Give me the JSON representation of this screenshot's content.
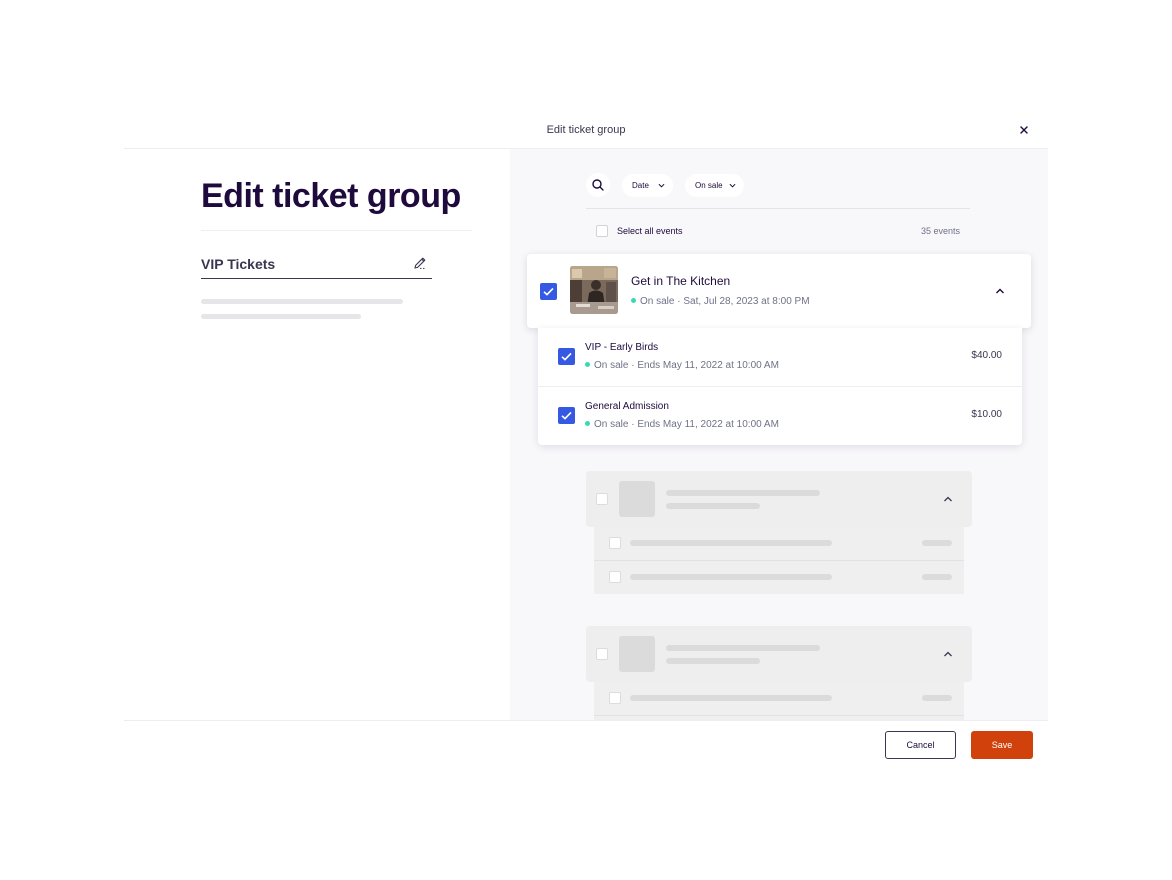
{
  "header": {
    "title": "Edit ticket group",
    "close_icon": "close-icon"
  },
  "left": {
    "title": "Edit ticket group",
    "group_name": "VIP Tickets",
    "edit_icon": "pencil-icon"
  },
  "toolbar": {
    "search_icon": "search-icon",
    "filters": [
      {
        "label": "Date"
      },
      {
        "label": "On sale"
      }
    ],
    "select_all_label": "Select all events",
    "event_count": "35 events"
  },
  "event": {
    "name": "Get in The Kitchen",
    "meta": "On sale · Sat, Jul 28, 2023 at 8:00 PM",
    "checked": true,
    "tickets": [
      {
        "name": "VIP - Early Birds",
        "meta": "On sale · Ends May 11, 2022 at 10:00 AM",
        "price": "$40.00",
        "checked": true
      },
      {
        "name": "General Admission",
        "meta": "On sale · Ends May 11, 2022 at 10:00 AM",
        "price": "$10.00",
        "checked": true
      }
    ]
  },
  "footer": {
    "cancel_label": "Cancel",
    "save_label": "Save"
  },
  "colors": {
    "accent_blue": "#3659e3",
    "brand_orange": "#d1410c",
    "status_green": "#3dd8b1",
    "text_dark": "#1e0a3c"
  }
}
